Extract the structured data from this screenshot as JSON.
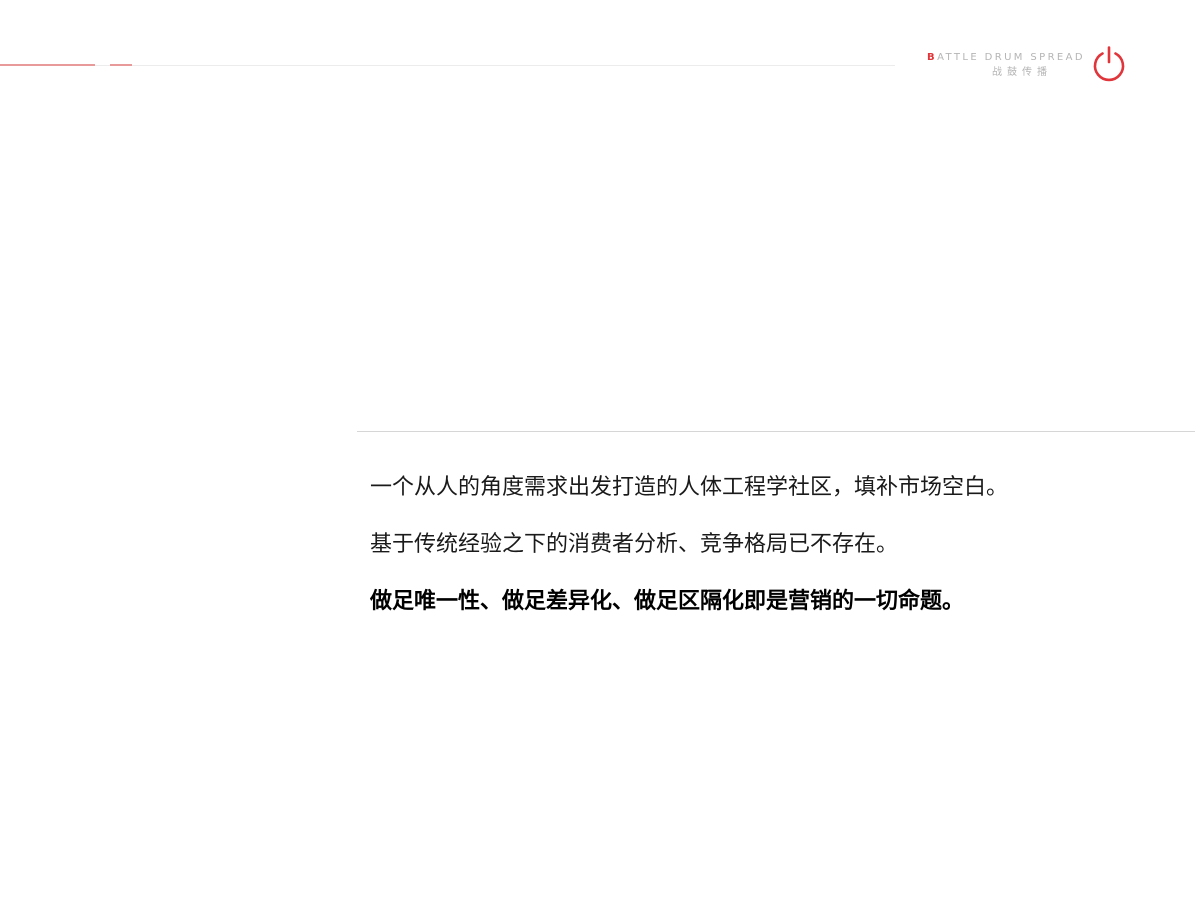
{
  "brand": {
    "en_first_letter": "B",
    "en_rest": "ATTLE DRUM SPREAD",
    "cn": "战鼓传播",
    "icon": "power-icon",
    "accent_color": "#e0353a"
  },
  "content": {
    "lines": [
      "一个从人的角度需求出发打造的人体工程学社区，填补市场空白。",
      "基于传统经验之下的消费者分析、竞争格局已不存在。",
      "做足唯一性、做足差异化、做足区隔化即是营销的一切命题。"
    ]
  }
}
